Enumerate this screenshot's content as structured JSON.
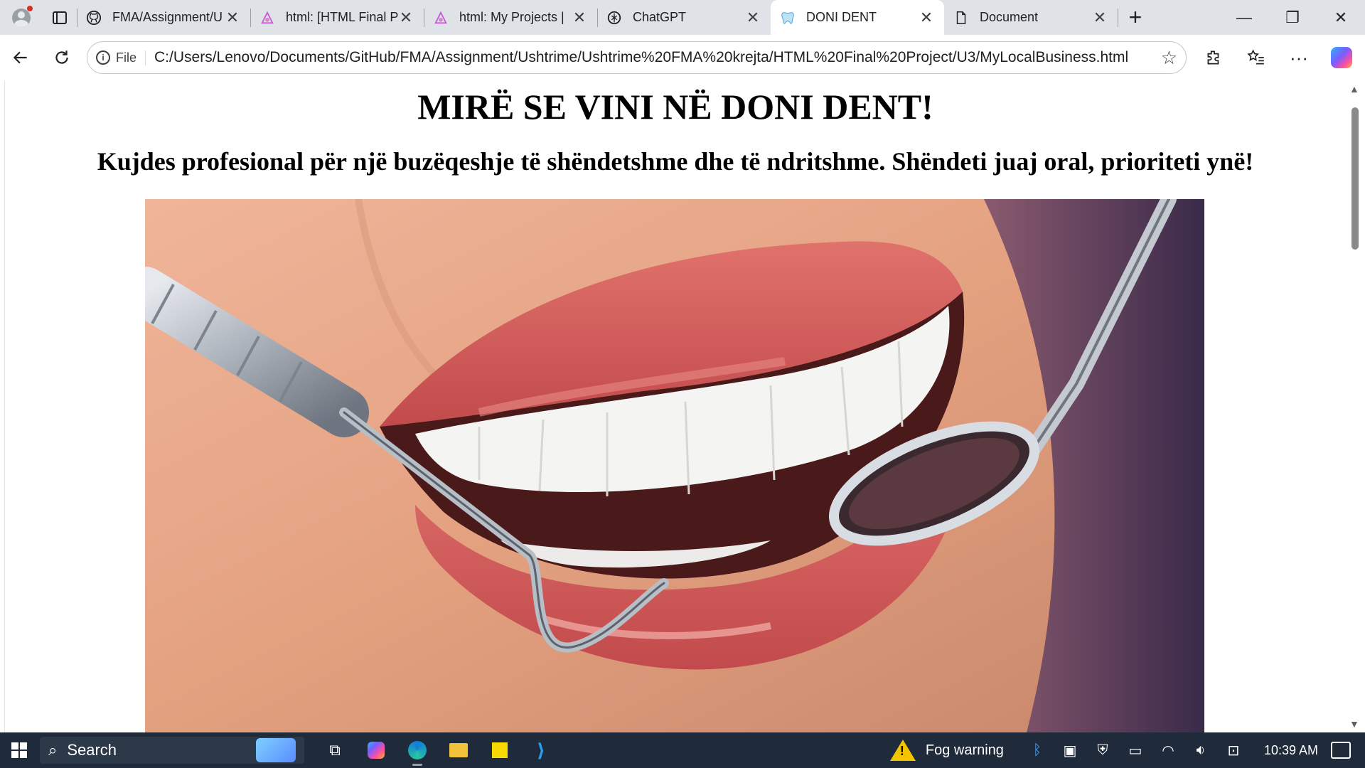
{
  "browser": {
    "tabs": [
      {
        "title": "FMA/Assignment/U",
        "icon": "github-icon",
        "active": false
      },
      {
        "title": "html: [HTML Final P",
        "icon": "w3-icon",
        "active": false
      },
      {
        "title": "html: My Projects |",
        "icon": "w3-icon",
        "active": false
      },
      {
        "title": "ChatGPT",
        "icon": "chatgpt-icon",
        "active": false
      },
      {
        "title": "DONI DENT",
        "icon": "tooth-icon",
        "active": true
      },
      {
        "title": "Document",
        "icon": "document-icon",
        "active": false
      }
    ],
    "address": {
      "scheme_label": "File",
      "url": "C:/Users/Lenovo/Documents/GitHub/FMA/Assignment/Ushtrime/Ushtrime%20FMA%20krejta/HTML%20Final%20Project/U3/MyLocalBusiness.html"
    }
  },
  "page": {
    "heading": "MIRË SE VINI NË DONI DENT!",
    "subheading": "Kujdes profesional për një buzëqeshje të shëndetshme dhe të ndritshme. Shëndeti juaj oral, prioriteti ynë!"
  },
  "taskbar": {
    "search_label": "Search",
    "weather": "Fog warning",
    "time": "10:39 AM"
  },
  "colors": {
    "taskbar_bg": "#1f2b3a",
    "tabstrip_bg": "#dfe3e8",
    "warning_yellow": "#f5c400"
  }
}
